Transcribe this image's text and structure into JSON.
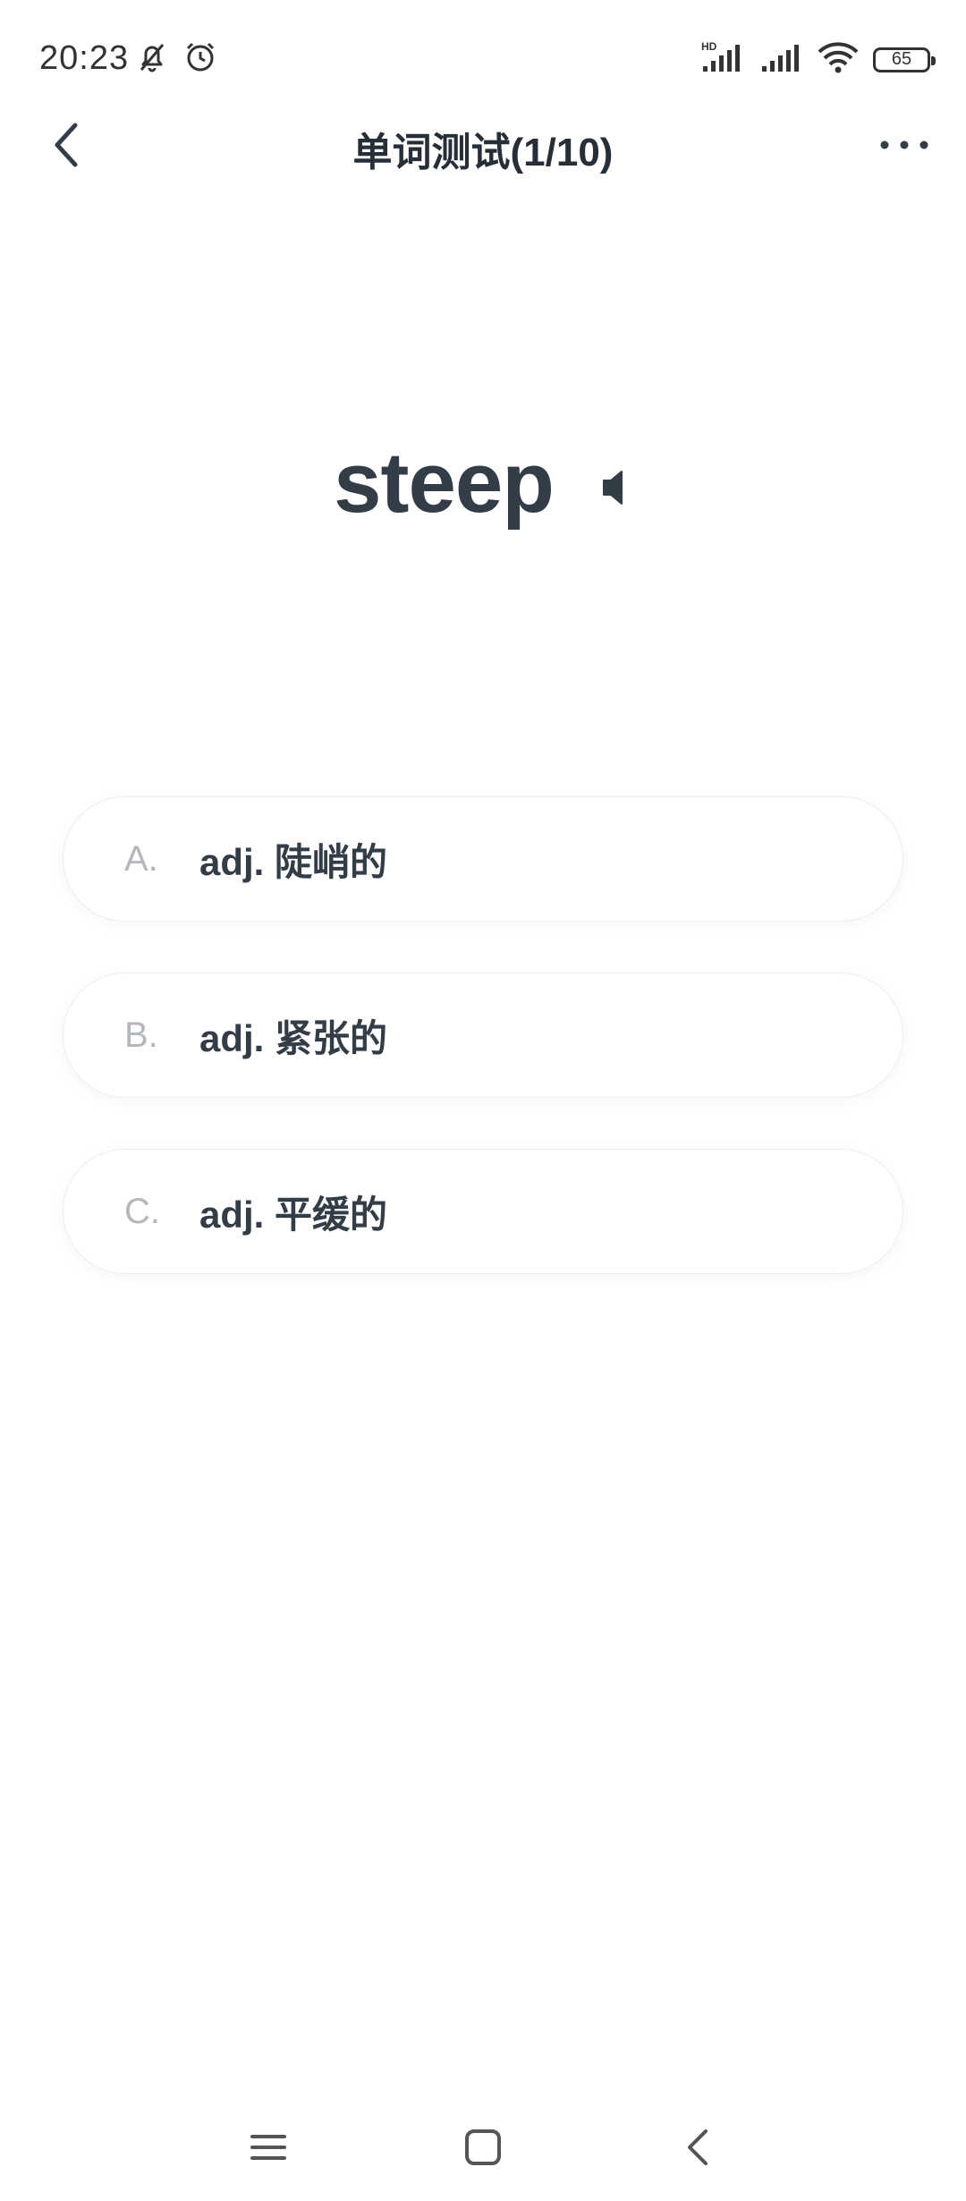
{
  "status_bar": {
    "time": "20:23",
    "battery": "65",
    "network_label": "HD"
  },
  "header": {
    "title": "单词测试(1/10)"
  },
  "word": {
    "text": "steep"
  },
  "options": [
    {
      "letter": "A.",
      "text": "adj. 陡峭的"
    },
    {
      "letter": "B.",
      "text": "adj. 紧张的"
    },
    {
      "letter": "C.",
      "text": "adj. 平缓的"
    }
  ],
  "colors": {
    "text_primary": "#333d47",
    "letter_gray": "#b4b8bc",
    "background": "#ffffff",
    "border": "#eeeeee"
  }
}
